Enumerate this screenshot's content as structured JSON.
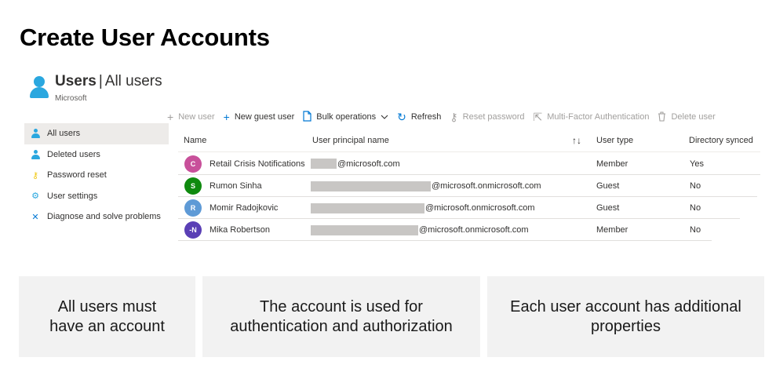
{
  "slide": {
    "title": "Create User Accounts"
  },
  "header": {
    "title": "Users",
    "separator": "|",
    "subtitle": "All users",
    "org": "Microsoft"
  },
  "toolbar": {
    "new_user": "New user",
    "new_guest_user": "New guest user",
    "bulk_operations": "Bulk operations",
    "refresh": "Refresh",
    "reset_password": "Reset password",
    "mfa": "Multi-Factor Authentication",
    "delete_user": "Delete user"
  },
  "sidebar": {
    "items": [
      {
        "label": "All users",
        "icon": "user-icon"
      },
      {
        "label": "Deleted users",
        "icon": "user-icon"
      },
      {
        "label": "Password reset",
        "icon": "key-icon"
      },
      {
        "label": "User settings",
        "icon": "user-settings-icon"
      },
      {
        "label": "Diagnose and solve problems",
        "icon": "wrench-icon"
      }
    ]
  },
  "table": {
    "columns": {
      "name": "Name",
      "upn": "User principal name",
      "sort_icon": "↑↓",
      "type": "User type",
      "sync": "Directory synced"
    },
    "rows": [
      {
        "initials": "C",
        "color": "#c8509a",
        "name": "Retail Crisis Notifications",
        "domain": "@microsoft.com",
        "type": "Member",
        "sync": "Yes"
      },
      {
        "initials": "S",
        "color": "#0f8a0f",
        "name": "Rumon Sinha",
        "domain": "@microsoft.onmicrosoft.com",
        "type": "Guest",
        "sync": "No"
      },
      {
        "initials": "R",
        "color": "#5e9ad6",
        "name": "Momir Radojkovic",
        "domain": "@microsoft.onmicrosoft.com",
        "type": "Guest",
        "sync": "No"
      },
      {
        "initials": "-N",
        "color": "#5a3fb5",
        "name": "Mika Robertson",
        "domain": "@microsoft.onmicrosoft.com",
        "type": "Member",
        "sync": "No"
      }
    ]
  },
  "cards": [
    {
      "line1": "All users must",
      "line2": "have an account"
    },
    {
      "line1": "The account is used for",
      "line2": "authentication and authorization"
    },
    {
      "line1": "Each user account has additional",
      "line2": "properties"
    }
  ]
}
